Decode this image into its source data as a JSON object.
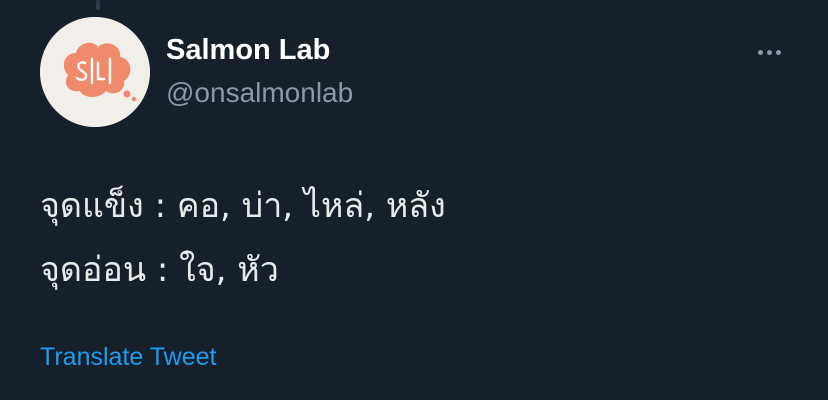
{
  "tweet": {
    "author": {
      "display_name": "Salmon Lab",
      "handle": "@onsalmonlab",
      "avatar_text": "S|L|"
    },
    "more_options_icon": "more-horizontal-icon",
    "text_lines": [
      "จุดแข็ง : คอ, บ่า, ไหล่, หลัง",
      "จุดอ่อน :  ใจ, หัว"
    ],
    "translate_label": "Translate Tweet"
  },
  "colors": {
    "background": "#15202b",
    "primary_text": "#e7e9ea",
    "secondary_text": "#8b98a5",
    "link": "#1d9bf0",
    "avatar_brand": "#f08a6c"
  }
}
